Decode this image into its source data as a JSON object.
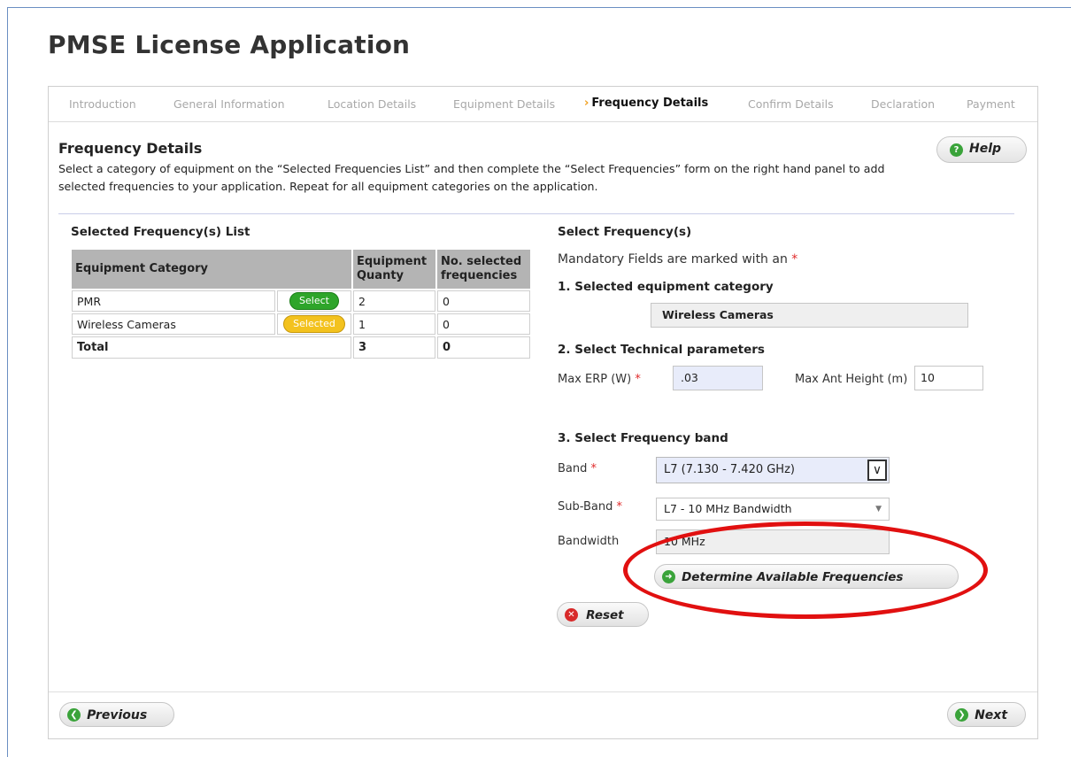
{
  "app": {
    "title": "PMSE License Application"
  },
  "steps": [
    {
      "label": "Introduction",
      "active": false
    },
    {
      "label": "General Information",
      "active": false
    },
    {
      "label": "Location Details",
      "active": false
    },
    {
      "label": "Equipment Details",
      "active": false
    },
    {
      "label": "Frequency Details",
      "active": true
    },
    {
      "label": "Confirm Details",
      "active": false
    },
    {
      "label": "Declaration",
      "active": false
    },
    {
      "label": "Payment",
      "active": false
    }
  ],
  "section": {
    "title": "Frequency Details",
    "instructions": "Select a category of equipment on the “Selected Frequencies List” and then complete the “Select Frequencies” form on the right hand panel to add selected frequencies to your application. Repeat for all equipment categories on the application.",
    "help_label": "Help"
  },
  "list": {
    "title": "Selected Frequency(s) List",
    "headers": {
      "category": "Equipment Category",
      "quantity": "Equipment Quanty",
      "selected": "No. selected frequencies"
    },
    "rows": [
      {
        "category": "PMR",
        "action": "Select",
        "quantity": "2",
        "selected": "0"
      },
      {
        "category": "Wireless Cameras",
        "action": "Selected",
        "quantity": "1",
        "selected": "0"
      }
    ],
    "total": {
      "label": "Total",
      "quantity": "3",
      "selected": "0"
    }
  },
  "form": {
    "title": "Select Frequency(s)",
    "mandatory_note": "Mandatory Fields are marked with an",
    "required_mark": "*",
    "step1": {
      "heading": "1. Selected equipment category",
      "value": "Wireless Cameras"
    },
    "step2": {
      "heading": "2. Select Technical parameters",
      "erp_label": "Max ERP (W)",
      "erp_value": ".03",
      "height_label": "Max Ant Height (m)",
      "height_value": "10"
    },
    "step3": {
      "heading": "3. Select Frequency band",
      "band_label": "Band",
      "band_value": "L7 (7.130 - 7.420 GHz)",
      "subband_label": "Sub-Band",
      "subband_value": "L7 - 10 MHz Bandwidth",
      "bandwidth_label": "Bandwidth",
      "bandwidth_value": "10 MHz"
    },
    "determine_label": "Determine Available Frequencies",
    "reset_label": "Reset"
  },
  "nav": {
    "previous_label": "Previous",
    "next_label": "Next"
  },
  "colors": {
    "accent_orange": "#f0a020",
    "select_green": "#2ea52a",
    "selected_yellow": "#f3c21e",
    "highlight_red": "#e11010",
    "required_red": "#e02a2a"
  },
  "icons": {
    "help": "question-icon",
    "determine": "arrow-right-circle-icon",
    "reset": "close-circle-icon",
    "previous": "arrow-left-circle-icon",
    "next": "arrow-right-circle-icon"
  }
}
